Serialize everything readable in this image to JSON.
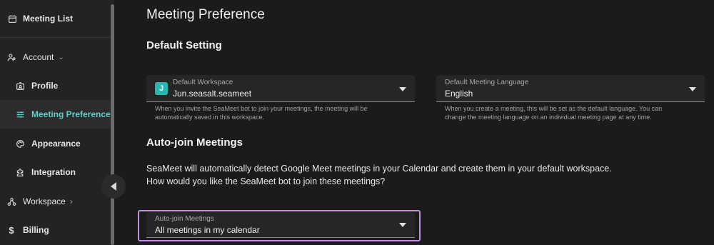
{
  "sidebar": {
    "meeting_list": "Meeting List",
    "account": "Account",
    "profile": "Profile",
    "meeting_preference": "Meeting Preference",
    "appearance": "Appearance",
    "integration": "Integration",
    "workspace": "Workspace",
    "billing": "Billing"
  },
  "main": {
    "title": "Meeting Preference",
    "default_setting": {
      "heading": "Default Setting",
      "workspace": {
        "label": "Default Workspace",
        "badge": "J",
        "value": "Jun.seasalt.seameet",
        "helper_line1": "When you invite the SeaMeet bot to join your meetings, the meeting will be",
        "helper_line2": "automatically saved in this workspace."
      },
      "language": {
        "label": "Default Meeting Language",
        "value": "English",
        "helper_line1": "When you create a meeting, this will be set as the default language. You can",
        "helper_line2": "change the meeting language on an individual meeting page at any time."
      }
    },
    "auto_join": {
      "heading": "Auto-join Meetings",
      "desc_line1": "SeaMeet will automatically detect Google Meet meetings in your Calendar and create them in your default workspace.",
      "desc_line2": "How would you like the SeaMeet bot to join these meetings?",
      "select": {
        "label": "Auto-join Meetings",
        "value": "All meetings in my calendar"
      }
    }
  },
  "colors": {
    "accent": "#5ecfc8",
    "highlight": "#c58be6",
    "badge": "#2ab7b0"
  }
}
